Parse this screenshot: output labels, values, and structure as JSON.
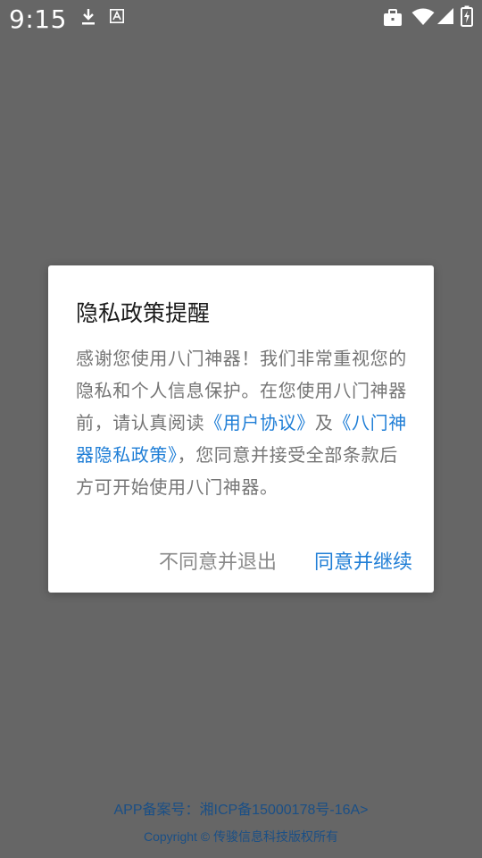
{
  "status_bar": {
    "time": "9:15",
    "icons": [
      "download-icon",
      "text-a-icon",
      "briefcase-icon",
      "wifi-icon",
      "signal-icon",
      "battery-charging-icon"
    ]
  },
  "dialog": {
    "title": "隐私政策提醒",
    "body_part1": "感谢您使用八门神器！我们非常重视您的隐私和个人信息保护。在您使用八门神器前，请认真阅读",
    "link_user_agreement": "《用户协议》",
    "body_and": "及",
    "link_privacy_policy": "《八门神器隐私政策》",
    "body_part2": "，您同意并接受全部条款后方可开始使用八门神器。",
    "disagree_label": "不同意并退出",
    "agree_label": "同意并继续"
  },
  "footer": {
    "icp_text": "APP备案号：湘ICP备15000178号-16A>",
    "copyright_text": "Copyright © 传骏信息科技版权所有"
  },
  "colors": {
    "overlay": "#666666",
    "link": "#1f7ed6",
    "footer_text": "#1a4f86"
  }
}
